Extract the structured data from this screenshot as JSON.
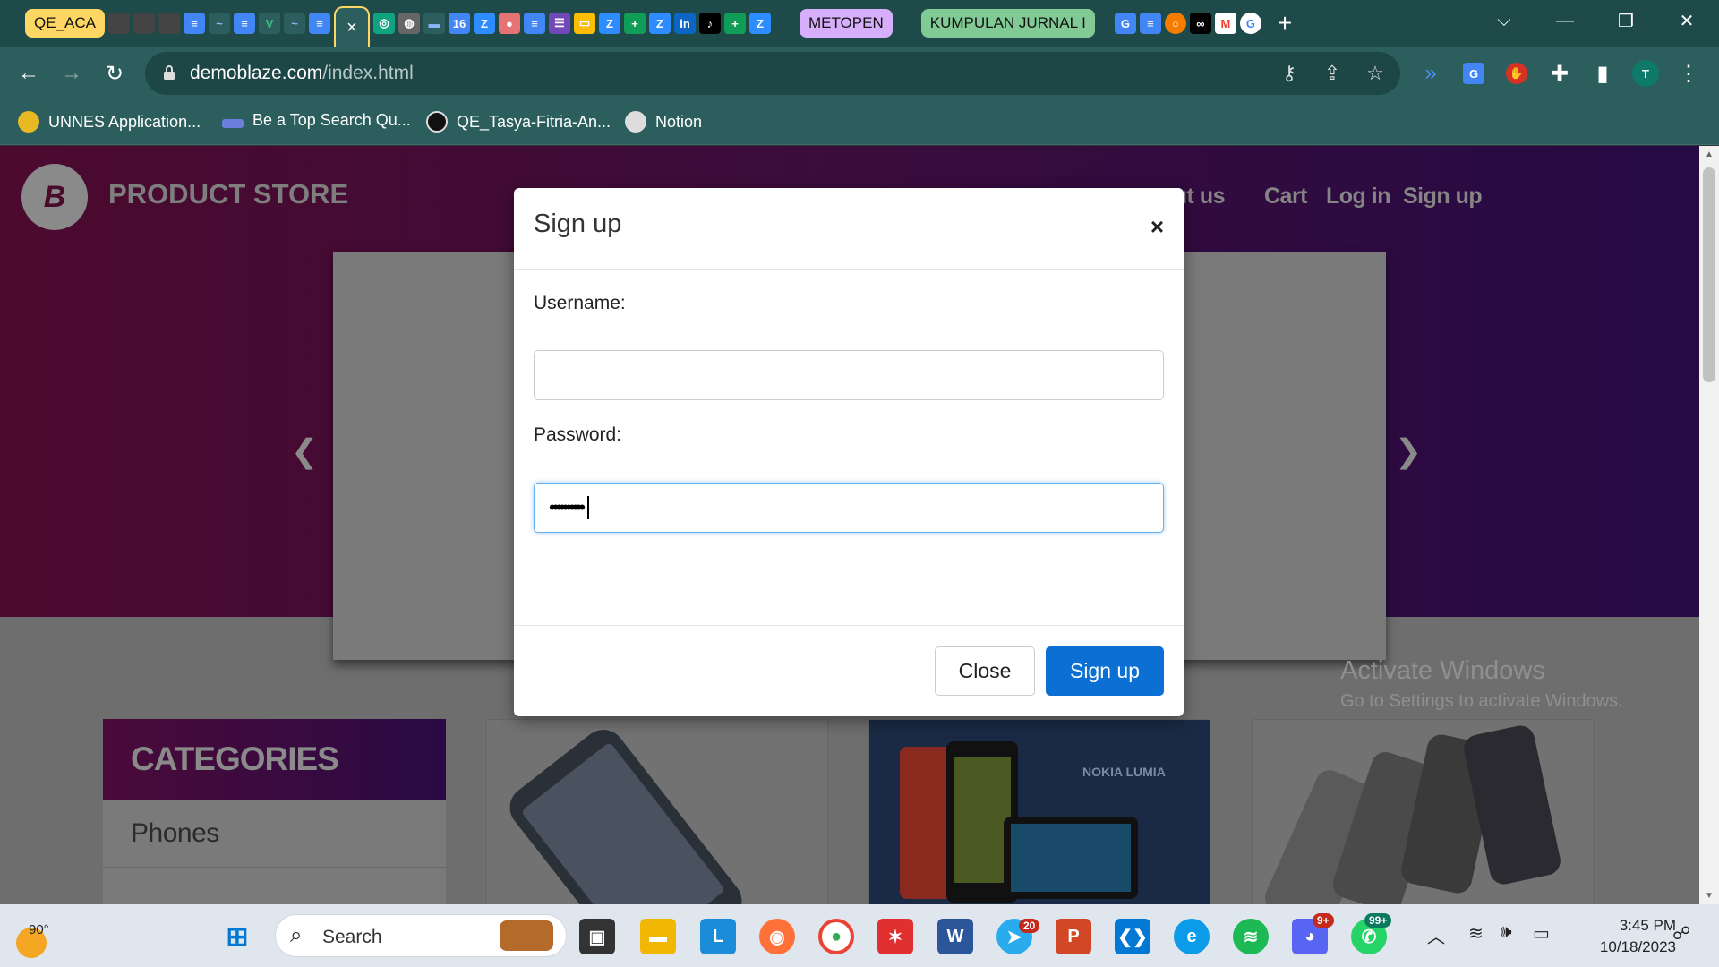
{
  "browser": {
    "tab_groups": {
      "group1": "QE_ACA",
      "group2": "METOPEN",
      "group3": "KUMPULAN JURNAL I"
    },
    "active_tab_close": "×",
    "new_tab": "+",
    "url_host": "demoblaze.com",
    "url_path": "/index.html",
    "profile_initial": "T",
    "bookmarks": [
      "UNNES Application...",
      "Be a Top Search Qu...",
      "QE_Tasya-Fitria-An...",
      "Notion"
    ]
  },
  "site": {
    "logo_letter": "B",
    "brand": "PRODUCT STORE",
    "nav": [
      "out us",
      "Cart",
      "Log in",
      "Sign up"
    ],
    "categories_title": "CATEGORIES",
    "categories": [
      "Phones"
    ],
    "card_text": "NOKIA LUMIA"
  },
  "modal": {
    "title": "Sign up",
    "close_x": "×",
    "username_label": "Username:",
    "username_value": "",
    "password_label": "Password:",
    "password_value": "••••••••••",
    "close_button": "Close",
    "submit_button": "Sign up"
  },
  "watermark": {
    "line1": "Activate Windows",
    "line2": "Go to Settings to activate Windows."
  },
  "taskbar": {
    "weather_temp": "90°",
    "search_placeholder": "Search",
    "badge_mail": "20",
    "badge_discord": "9+",
    "badge_whatsapp": "99+",
    "time": "3:45 PM",
    "date": "10/18/2023"
  },
  "colors": {
    "chrome_dark": "#1f4a4a",
    "chrome_toolbar": "#2c5e5e",
    "primary_button": "#0c6fd3",
    "hero_start": "#4c0a2e",
    "hero_end": "#250a44"
  }
}
